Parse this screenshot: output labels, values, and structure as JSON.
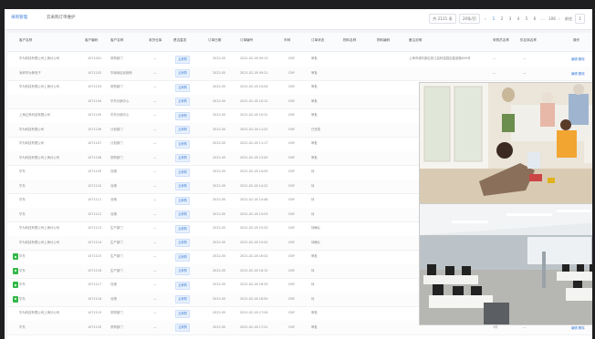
{
  "tabs": [
    "采购管理",
    "云采购订单维护"
  ],
  "pager": {
    "total": "共 2121 条",
    "per_page": "20条/页",
    "pages": [
      "1",
      "2",
      "3",
      "4",
      "5",
      "6"
    ],
    "ellipsis": "...",
    "last": "106",
    "jump_label": "前往",
    "jump_value": "1"
  },
  "columns": [
    "客户名称",
    "客户编码",
    "客户名称",
    "收货仓库",
    "是否直发",
    "订单日期",
    "订单编号",
    "币种",
    "订单状态",
    "物料名称",
    "物料编码",
    "备注说明",
    "采购员名称",
    "供应商名称",
    "操作"
  ],
  "rows": [
    {
      "name": "华为科技有限公司上海分公司",
      "code": "1071001",
      "cname": "采购部门",
      "date": "2022-05",
      "no": "2021-02-18 09:13",
      "cur": "CNY",
      "status": "审批",
      "note": "上海市浦东新区张江高科技园区碧波路690号",
      "buyer": "—",
      "vendor": "—"
    },
    {
      "name": "深圳市为美电子",
      "code": "1071102",
      "cname": "华南地区经销商",
      "date": "2022-05",
      "no": "2021-02-18 09:21",
      "cur": "CNY",
      "status": "审批",
      "note": "",
      "buyer": "—",
      "vendor": "—"
    },
    {
      "name": "华为科技有限公司上海分公司",
      "code": "1071103",
      "cname": "采购部门",
      "date": "2022-05",
      "no": "2021-02-18 10:04",
      "cur": "CNY",
      "status": "审批",
      "note": "",
      "buyer": "—",
      "vendor": "—"
    },
    {
      "name": "",
      "code": "1071104",
      "cname": "华东分销中心",
      "date": "2022-05",
      "no": "2021-02-18 10:12",
      "cur": "CNY",
      "status": "审批",
      "note": "",
      "buyer": "—",
      "vendor": "—"
    },
    {
      "name": "上海云采科技有限公司",
      "code": "1071105",
      "cname": "华东分销中心",
      "date": "2022-05",
      "no": "2021-02-18 10:31",
      "cur": "CNY",
      "status": "审批",
      "note": "",
      "buyer": "—",
      "vendor": "—"
    },
    {
      "name": "华为科技有限公司",
      "code": "1071106",
      "cname": "计划部门",
      "date": "2022-05",
      "no": "2021-02-18 11:02",
      "cur": "CNY",
      "status": "已完成",
      "note": "",
      "buyer": "—",
      "vendor": "—"
    },
    {
      "name": "华为科技有限公司",
      "code": "1071107",
      "cname": "计划部门",
      "date": "2022-05",
      "no": "2021-02-18 11:17",
      "cur": "CNY",
      "status": "审批",
      "note": "",
      "buyer": "—",
      "vendor": "—"
    },
    {
      "name": "华为科技有限公司上海分公司",
      "code": "1071108",
      "cname": "采购部门",
      "date": "2022-05",
      "no": "2021-02-18 13:40",
      "cur": "CNY",
      "status": "审批",
      "note": "",
      "buyer": "—",
      "vendor": "—"
    },
    {
      "name": "华东",
      "code": "1071109",
      "cname": "仓储",
      "date": "2022-05",
      "no": "2021-02-18 14:05",
      "cur": "CNY",
      "status": "待",
      "note": "",
      "buyer": "—",
      "vendor": "—"
    },
    {
      "name": "华东",
      "code": "1071110",
      "cname": "仓储",
      "date": "2022-05",
      "no": "2021-02-18 14:22",
      "cur": "CNY",
      "status": "待",
      "note": "",
      "buyer": "—",
      "vendor": "—"
    },
    {
      "name": "华东",
      "code": "1071111",
      "cname": "仓储",
      "date": "2022-05",
      "no": "2021-02-18 14:48",
      "cur": "CNY",
      "status": "待",
      "note": "",
      "buyer": "—",
      "vendor": "—"
    },
    {
      "name": "华东",
      "code": "1071112",
      "cname": "仓储",
      "date": "2022-05",
      "no": "2021-02-18 15:03",
      "cur": "CNY",
      "status": "待",
      "note": "",
      "buyer": "—",
      "vendor": "—"
    },
    {
      "name": "华为科技有限公司上海分公司",
      "code": "1071113",
      "cname": "生产部门",
      "date": "2022-05",
      "no": "2021-02-18 15:20",
      "cur": "CNY",
      "status": "待确认",
      "note": "",
      "buyer": "—",
      "vendor": "—"
    },
    {
      "name": "华为科技有限公司上海分公司",
      "code": "1071114",
      "cname": "生产部门",
      "date": "2022-05",
      "no": "2021-02-18 15:41",
      "cur": "CNY",
      "status": "待确认",
      "note": "",
      "buyer": "—",
      "vendor": "—"
    },
    {
      "name": "华东",
      "code": "1071115",
      "cname": "生产部门",
      "date": "2022-05",
      "no": "2021-02-18 16:02",
      "cur": "CNY",
      "status": "审批",
      "note": "",
      "buyer": "—",
      "vendor": "—"
    },
    {
      "name": "华东",
      "code": "1071116",
      "cname": "生产部门",
      "date": "2022-05",
      "no": "2021-02-18 16:15",
      "cur": "CNY",
      "status": "待",
      "note": "",
      "buyer": "—",
      "vendor": "—"
    },
    {
      "name": "华东",
      "code": "1071117",
      "cname": "仓储",
      "date": "2022-05",
      "no": "2021-02-18 16:33",
      "cur": "CNY",
      "status": "待",
      "note": "",
      "buyer": "—",
      "vendor": "—"
    },
    {
      "name": "华东",
      "code": "1071118",
      "cname": "仓储",
      "date": "2022-05",
      "no": "2021-02-18 16:50",
      "cur": "CNY",
      "status": "待",
      "note": "",
      "buyer": "—",
      "vendor": "—"
    },
    {
      "name": "华为科技有限公司上海分公司",
      "code": "1071119",
      "cname": "采购部门",
      "date": "2022-05",
      "no": "2021-02-18 17:04",
      "cur": "CNY",
      "status": "审批",
      "note": "",
      "buyer": "1件",
      "vendor": "—"
    },
    {
      "name": "华东",
      "code": "1071120",
      "cname": "采购部门",
      "date": "2022-05",
      "no": "2021-02-18 17:21",
      "cur": "CNY",
      "status": "审批",
      "note": "",
      "buyer": "1件",
      "vendor": "—"
    }
  ],
  "row_tag": "云采购",
  "row_tag_extra": "—",
  "row_action": "编辑  删除",
  "colors": {
    "accent": "#3a7bd5",
    "success": "#33b84a"
  }
}
